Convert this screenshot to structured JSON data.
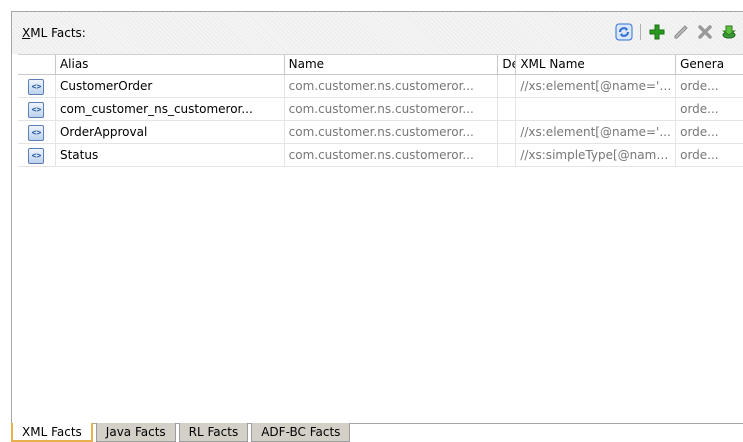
{
  "header": {
    "title_mnemonic": "X",
    "title_rest": "ML Facts:"
  },
  "toolbar": {
    "icons": [
      "refresh-icon",
      "add-icon",
      "edit-icon",
      "delete-icon",
      "import-icon"
    ]
  },
  "table": {
    "columns": [
      "Alias",
      "Name",
      "De",
      "XML Name",
      "Genera"
    ],
    "rows": [
      {
        "alias": "CustomerOrder",
        "name": "com.customer.ns.customeror...",
        "desc": "",
        "xml_name": "//xs:element[@name='C...",
        "generated": "orde..."
      },
      {
        "alias": "com_customer_ns_customeror...",
        "name": "com.customer.ns.customeror...",
        "desc": "",
        "xml_name": "",
        "generated": "orde..."
      },
      {
        "alias": "OrderApproval",
        "name": "com.customer.ns.customeror...",
        "desc": "",
        "xml_name": "//xs:element[@name='...",
        "generated": "orde..."
      },
      {
        "alias": "Status",
        "name": "com.customer.ns.customeror...",
        "desc": "",
        "xml_name": "//xs:simpleType[@name...",
        "generated": "orde..."
      }
    ]
  },
  "tabs": [
    "XML Facts",
    "Java Facts",
    "RL Facts",
    "ADF-BC Facts"
  ],
  "colors": {
    "active_tab_border": "#e8b04b",
    "add_green": "#2a9a1f",
    "refresh_blue": "#2f6fd0"
  }
}
